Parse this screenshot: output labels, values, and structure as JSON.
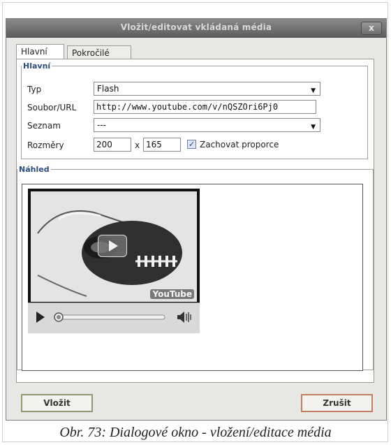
{
  "dialog": {
    "title": "Vložit/editovat vkládaná média",
    "close_label": "x"
  },
  "tabs": [
    {
      "label": "Hlavní"
    },
    {
      "label": "Pokročilé"
    }
  ],
  "general": {
    "legend": "Hlavní",
    "type_label": "Typ",
    "type_value": "Flash",
    "url_label": "Soubor/URL",
    "url_value": "http://www.youtube.com/v/nQSZOri6Pj0",
    "list_label": "Seznam",
    "list_value": "---",
    "size_label": "Rozměry",
    "width_value": "200",
    "times_sign": "x",
    "height_value": "165",
    "keep_ratio_label": "Zachovat proporce",
    "keep_ratio_checked": true
  },
  "preview": {
    "legend": "Náhled",
    "logo_text": "YouTube"
  },
  "buttons": {
    "insert": "Vložit",
    "cancel": "Zrušit"
  },
  "caption": "Obr. 73: Dialogové okno - vložení/editace média"
}
